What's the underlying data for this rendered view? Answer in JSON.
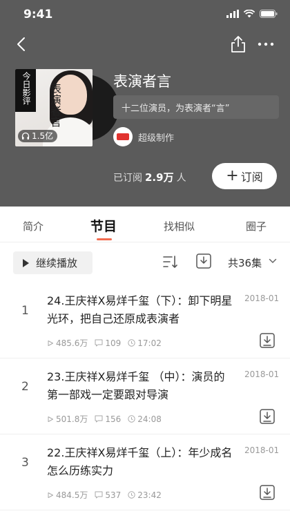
{
  "status_bar": {
    "time": "9:41"
  },
  "album": {
    "cover_logo_text": "今日影评",
    "cover_title_text": "表演者言",
    "cover_play_count": "1.5亿",
    "title": "表演者言",
    "description": "十二位演员，为表演者“言”",
    "creator": "超级制作",
    "subscribers_prefix": "已订阅",
    "subscribers_count": "2.9万",
    "subscribers_suffix": "人",
    "subscribe_label": "订阅"
  },
  "tabs": [
    {
      "label": "简介"
    },
    {
      "label": "节目"
    },
    {
      "label": "找相似"
    },
    {
      "label": "圈子"
    }
  ],
  "toolbar": {
    "play_label": "继续播放",
    "count_label": "共36集"
  },
  "episodes": [
    {
      "index": "1",
      "title": "24.王庆祥X易烊千玺（下）：卸下明星光环，把自己还原成表演者",
      "date": "2018-01",
      "plays": "485.6万",
      "comments": "109",
      "duration": "17:02"
    },
    {
      "index": "2",
      "title": "23.王庆祥X易烊千玺 （中）：演员的第一部戏一定要跟对导演",
      "date": "2018-01",
      "plays": "501.8万",
      "comments": "156",
      "duration": "24:08"
    },
    {
      "index": "3",
      "title": "22.王庆祥X易烊千玺（上）：年少成名怎么历练实力",
      "date": "2018-01",
      "plays": "484.5万",
      "comments": "537",
      "duration": "23:42"
    }
  ],
  "colors": {
    "header_bg": "#5b5b5b",
    "accent": "#f26b4f",
    "muted_text": "#999999"
  }
}
